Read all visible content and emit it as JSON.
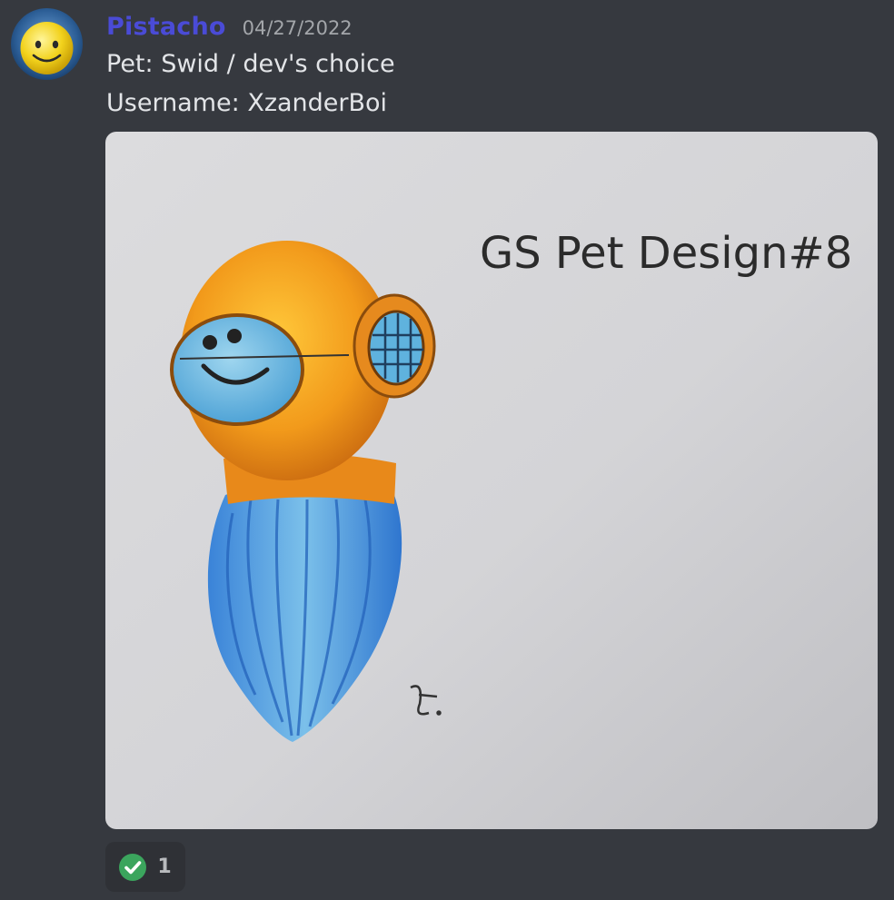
{
  "message": {
    "author": "Pistacho",
    "timestamp": "04/27/2022",
    "lines": [
      "Pet: Swid / dev's choice",
      "Username: XzanderBoi"
    ]
  },
  "attachment": {
    "handwritten_caption": "GS  Pet Design#8",
    "signature": "signature glyph"
  },
  "reaction": {
    "emoji": "white-check-mark-icon",
    "count": "1"
  },
  "colors": {
    "background": "#36393f",
    "author_name": "#4a4bd6",
    "reaction_bg": "#2f3136",
    "check_green": "#3ba55d"
  }
}
